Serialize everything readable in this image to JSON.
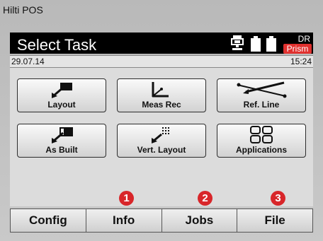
{
  "app": {
    "title": "Hilti POS"
  },
  "header": {
    "title": "Select Task",
    "mode_top": "DR",
    "mode_bottom": "Prism"
  },
  "status": {
    "date": "29.07.14",
    "time": "15:24"
  },
  "tasks": [
    {
      "label": "Layout",
      "icon": "layout-icon"
    },
    {
      "label": "Meas Rec",
      "icon": "measure-record-icon"
    },
    {
      "label": "Ref. Line",
      "icon": "reference-line-icon"
    },
    {
      "label": "As Built",
      "icon": "as-built-icon"
    },
    {
      "label": "Vert. Layout",
      "icon": "vertical-layout-icon"
    },
    {
      "label": "Applications",
      "icon": "applications-icon"
    }
  ],
  "softkeys": [
    "Config",
    "Info",
    "Jobs",
    "File"
  ],
  "callouts": [
    "1",
    "2",
    "3"
  ],
  "colors": {
    "accent": "#d8262a",
    "prism": "#e0312f",
    "titlebar": "#000000"
  }
}
